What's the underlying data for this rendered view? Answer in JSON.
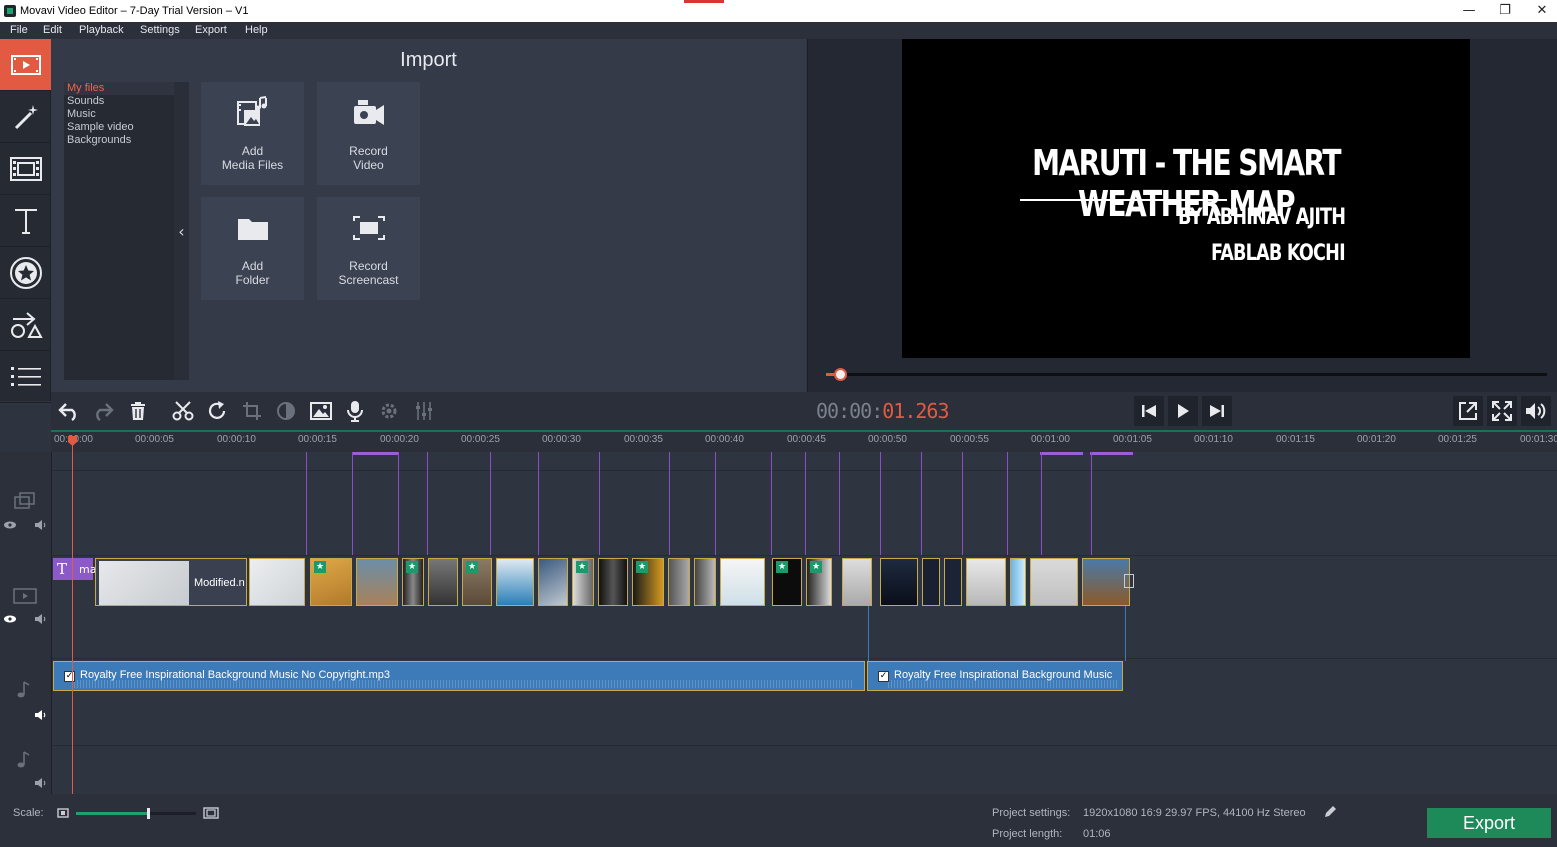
{
  "window": {
    "title": "Movavi Video Editor – 7-Day Trial Version – V1",
    "controls": [
      "—",
      "❐",
      "✕"
    ]
  },
  "menu": [
    "File",
    "Edit",
    "Playback",
    "Settings",
    "Export",
    "Help"
  ],
  "sidebar": {
    "tools": [
      "import-icon",
      "magic-wand-icon",
      "filmstrip-icon",
      "text-icon",
      "star-sticker-icon",
      "transitions-shapes-icon",
      "list-icon"
    ]
  },
  "import": {
    "title": "Import",
    "categories": [
      {
        "label": "My files",
        "active": true
      },
      {
        "label": "Sounds"
      },
      {
        "label": "Music"
      },
      {
        "label": "Sample video"
      },
      {
        "label": "Backgrounds"
      }
    ],
    "collapse_label": "‹",
    "tiles": [
      {
        "line1": "Add",
        "line2": "Media Files",
        "icon": "media-files-icon"
      },
      {
        "line1": "Record",
        "line2": "Video",
        "icon": "camera-icon"
      },
      {
        "line1": "Add",
        "line2": "Folder",
        "icon": "folder-icon"
      },
      {
        "line1": "Record",
        "line2": "Screencast",
        "icon": "screencast-icon"
      }
    ]
  },
  "preview": {
    "title": "MARUTI - THE SMART WEATHER MAP",
    "byline": "BY ABHINAV AJITH",
    "lab": "FABLAB KOCHI",
    "progress": 0.02
  },
  "toolbar": {
    "tools": [
      "undo-icon",
      "redo-icon",
      "delete-icon",
      "scissors-icon",
      "rotate-icon",
      "crop-icon",
      "color-adjust-icon",
      "image-icon",
      "microphone-icon",
      "settings-icon",
      "equalizer-icon"
    ],
    "timecode_dim": "00:00:",
    "timecode_red": "01.263",
    "playback": [
      "skip-back-icon",
      "play-icon",
      "skip-forward-icon"
    ],
    "view": [
      "popout-icon",
      "fullscreen-icon",
      "volume-icon"
    ]
  },
  "ruler": {
    "labels": [
      "00:00:00",
      "00:00:05",
      "00:00:10",
      "00:00:15",
      "00:00:20",
      "00:00:25",
      "00:00:30",
      "00:00:35",
      "00:00:40",
      "00:00:45",
      "00:00:50",
      "00:00:55",
      "00:01:00",
      "00:01:05",
      "00:01:10",
      "00:01:15",
      "00:01:20",
      "00:01:25",
      "00:01:30"
    ]
  },
  "timeline": {
    "title_clip_label": "ma",
    "video_clip_label": "Modified.n",
    "audio_clips": [
      "Royalty Free Inspirational Background Music No Copyright.mp3",
      "Royalty Free Inspirational Background Music"
    ]
  },
  "status": {
    "scale_label": "Scale:",
    "scale_value": 0.6,
    "project_settings_label": "Project settings:",
    "project_settings_value": "1920x1080 16:9 29.97 FPS, 44100 Hz Stereo",
    "project_length_label": "Project length:",
    "project_length_value": "01:06",
    "export_label": "Export"
  },
  "colors": {
    "accent": "#e25a42",
    "export_green": "#1e8a5a",
    "audio_blue": "#3d7ab8",
    "transition_purple": "#8b4ec8"
  }
}
